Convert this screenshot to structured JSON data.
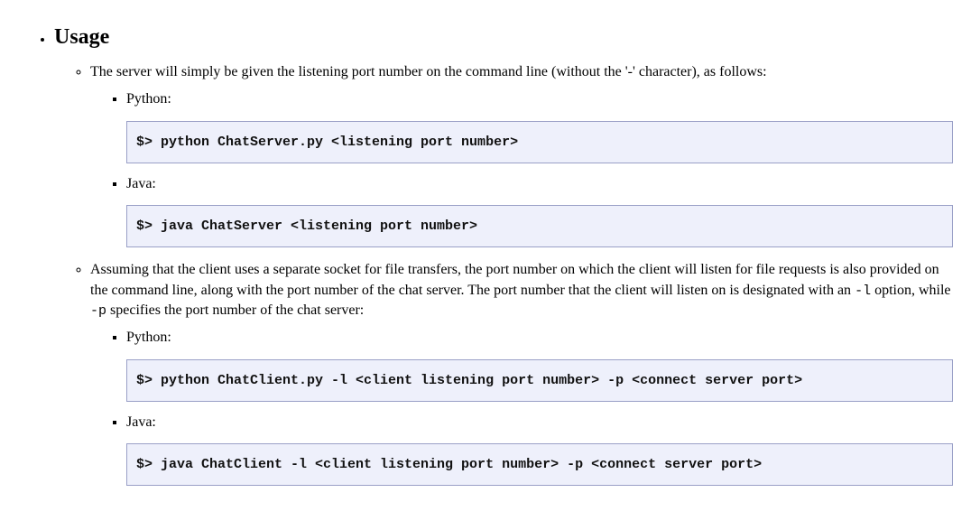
{
  "heading": "Usage",
  "server": {
    "intro": "The server will simply be given the listening port number on the command line (without the '-' character), as follows:",
    "python_label": "Python:",
    "python_cmd": "$> python ChatServer.py <listening port number>",
    "java_label": "Java:",
    "java_cmd": "$> java ChatServer <listening port number>"
  },
  "client": {
    "intro_part1": "Assuming that the client uses a separate socket for file transfers, the port number on which the client will listen for file requests is also provided on the command line, along with the port number of the chat server. The port number that the client will listen on is designated with an ",
    "opt_l": "-l",
    "intro_part2": " option, while ",
    "opt_p": "-p",
    "intro_part3": " specifies the port number of the chat server:",
    "python_label": "Python:",
    "python_cmd": "$> python ChatClient.py -l <client listening port number> -p <connect server port>",
    "java_label": "Java:",
    "java_cmd": "$> java ChatClient -l <client listening port number> -p <connect server port>"
  }
}
